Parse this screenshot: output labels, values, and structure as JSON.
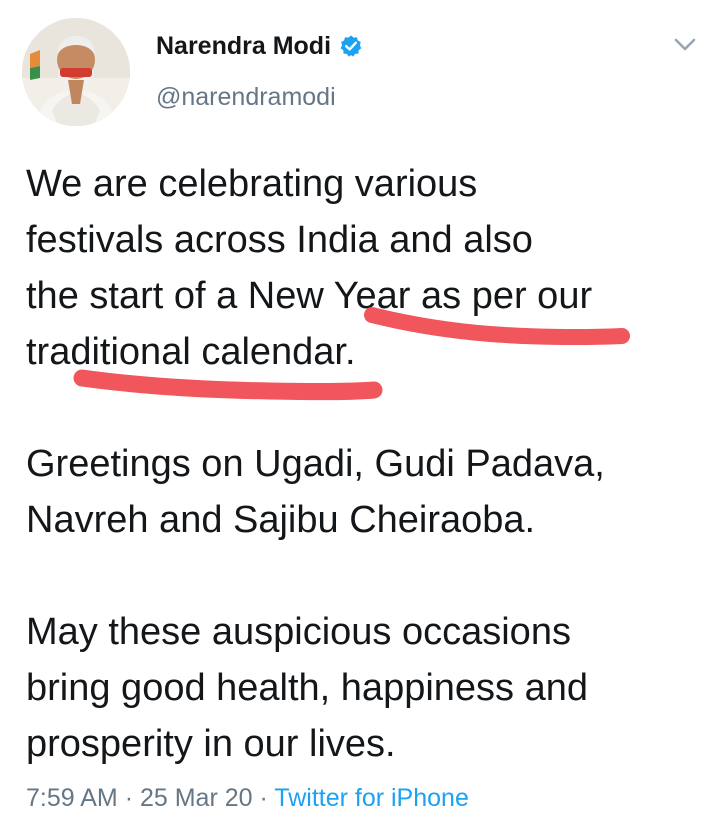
{
  "author": {
    "display_name": "Narendra Modi",
    "handle": "@narendramodi",
    "verified": true,
    "verified_color": "#1da1f2"
  },
  "tweet": {
    "paragraphs": [
      [
        "We are celebrating various",
        "festivals across India and also",
        "the start of a New Year as per our",
        "traditional calendar."
      ],
      [
        "Greetings on Ugadi, Gudi Padava,",
        "Navreh and Sajibu Cheiraoba."
      ],
      [
        "May these auspicious occasions",
        "bring good health, happiness and",
        "prosperity in our lives."
      ]
    ],
    "time": "7:59 AM",
    "date": "25 Mar 20",
    "separator": "·",
    "source": "Twitter for iPhone"
  },
  "annotation": {
    "color": "#f0565b",
    "kind": "hand-drawn underline",
    "underlined_phrases": [
      "Year as per our",
      "traditional calendar"
    ]
  },
  "icons": [
    "verified-badge-icon",
    "chevron-down-icon"
  ],
  "colors": {
    "text": "#14171a",
    "secondary": "#657786",
    "link": "#1da1f2"
  }
}
